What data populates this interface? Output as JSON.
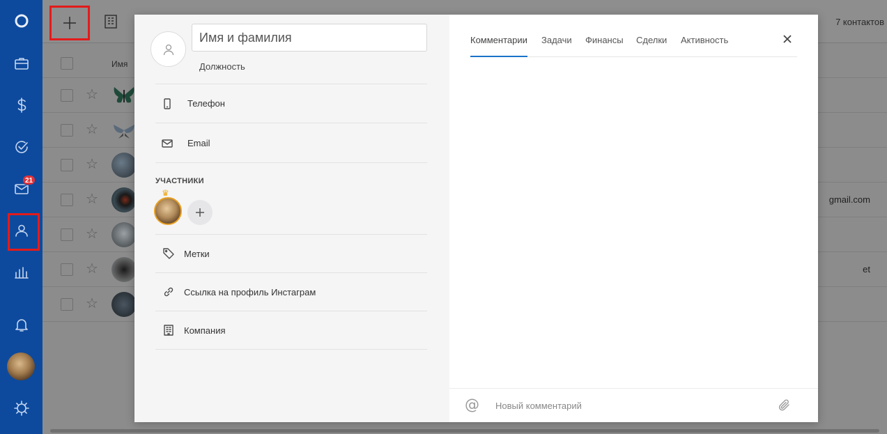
{
  "sidebar": {
    "items": [
      {
        "name": "logo-icon"
      },
      {
        "name": "briefcase-icon"
      },
      {
        "name": "dollar-icon"
      },
      {
        "name": "check-circle-icon"
      },
      {
        "name": "mail-icon",
        "badge": "21"
      },
      {
        "name": "contacts-icon"
      },
      {
        "name": "chart-icon"
      },
      {
        "name": "bell-icon"
      },
      {
        "name": "settings-icon"
      }
    ]
  },
  "toolbar": {
    "contacts_count": "7 контактов"
  },
  "table": {
    "header_name": "Имя",
    "rows": [
      {
        "avatar": "butterfly",
        "text": ""
      },
      {
        "avatar": "butterfly",
        "text": ""
      },
      {
        "avatar": "photo",
        "text": ""
      },
      {
        "avatar": "photo",
        "text": "gmail.com"
      },
      {
        "avatar": "photo",
        "text": ""
      },
      {
        "avatar": "photo",
        "text": "et"
      },
      {
        "avatar": "photo",
        "text": ""
      }
    ]
  },
  "modal": {
    "name_placeholder": "Имя и фамилия",
    "position_label": "Должность",
    "phone_label": "Телефон",
    "email_label": "Email",
    "participants_title": "УЧАСТНИКИ",
    "tags_label": "Метки",
    "instagram_label": "Ссылка на профиль Инстаграм",
    "company_label": "Компания",
    "tabs": [
      {
        "label": "Комментарии",
        "active": true
      },
      {
        "label": "Задачи",
        "active": false
      },
      {
        "label": "Финансы",
        "active": false
      },
      {
        "label": "Сделки",
        "active": false
      },
      {
        "label": "Активность",
        "active": false
      }
    ],
    "comment_placeholder": "Новый комментарий"
  },
  "colors": {
    "sidebar": "#0d4a9e",
    "accent": "#1a73c8",
    "highlight": "#e31b1b",
    "badge": "#e0323a",
    "crown": "#f0a818"
  }
}
